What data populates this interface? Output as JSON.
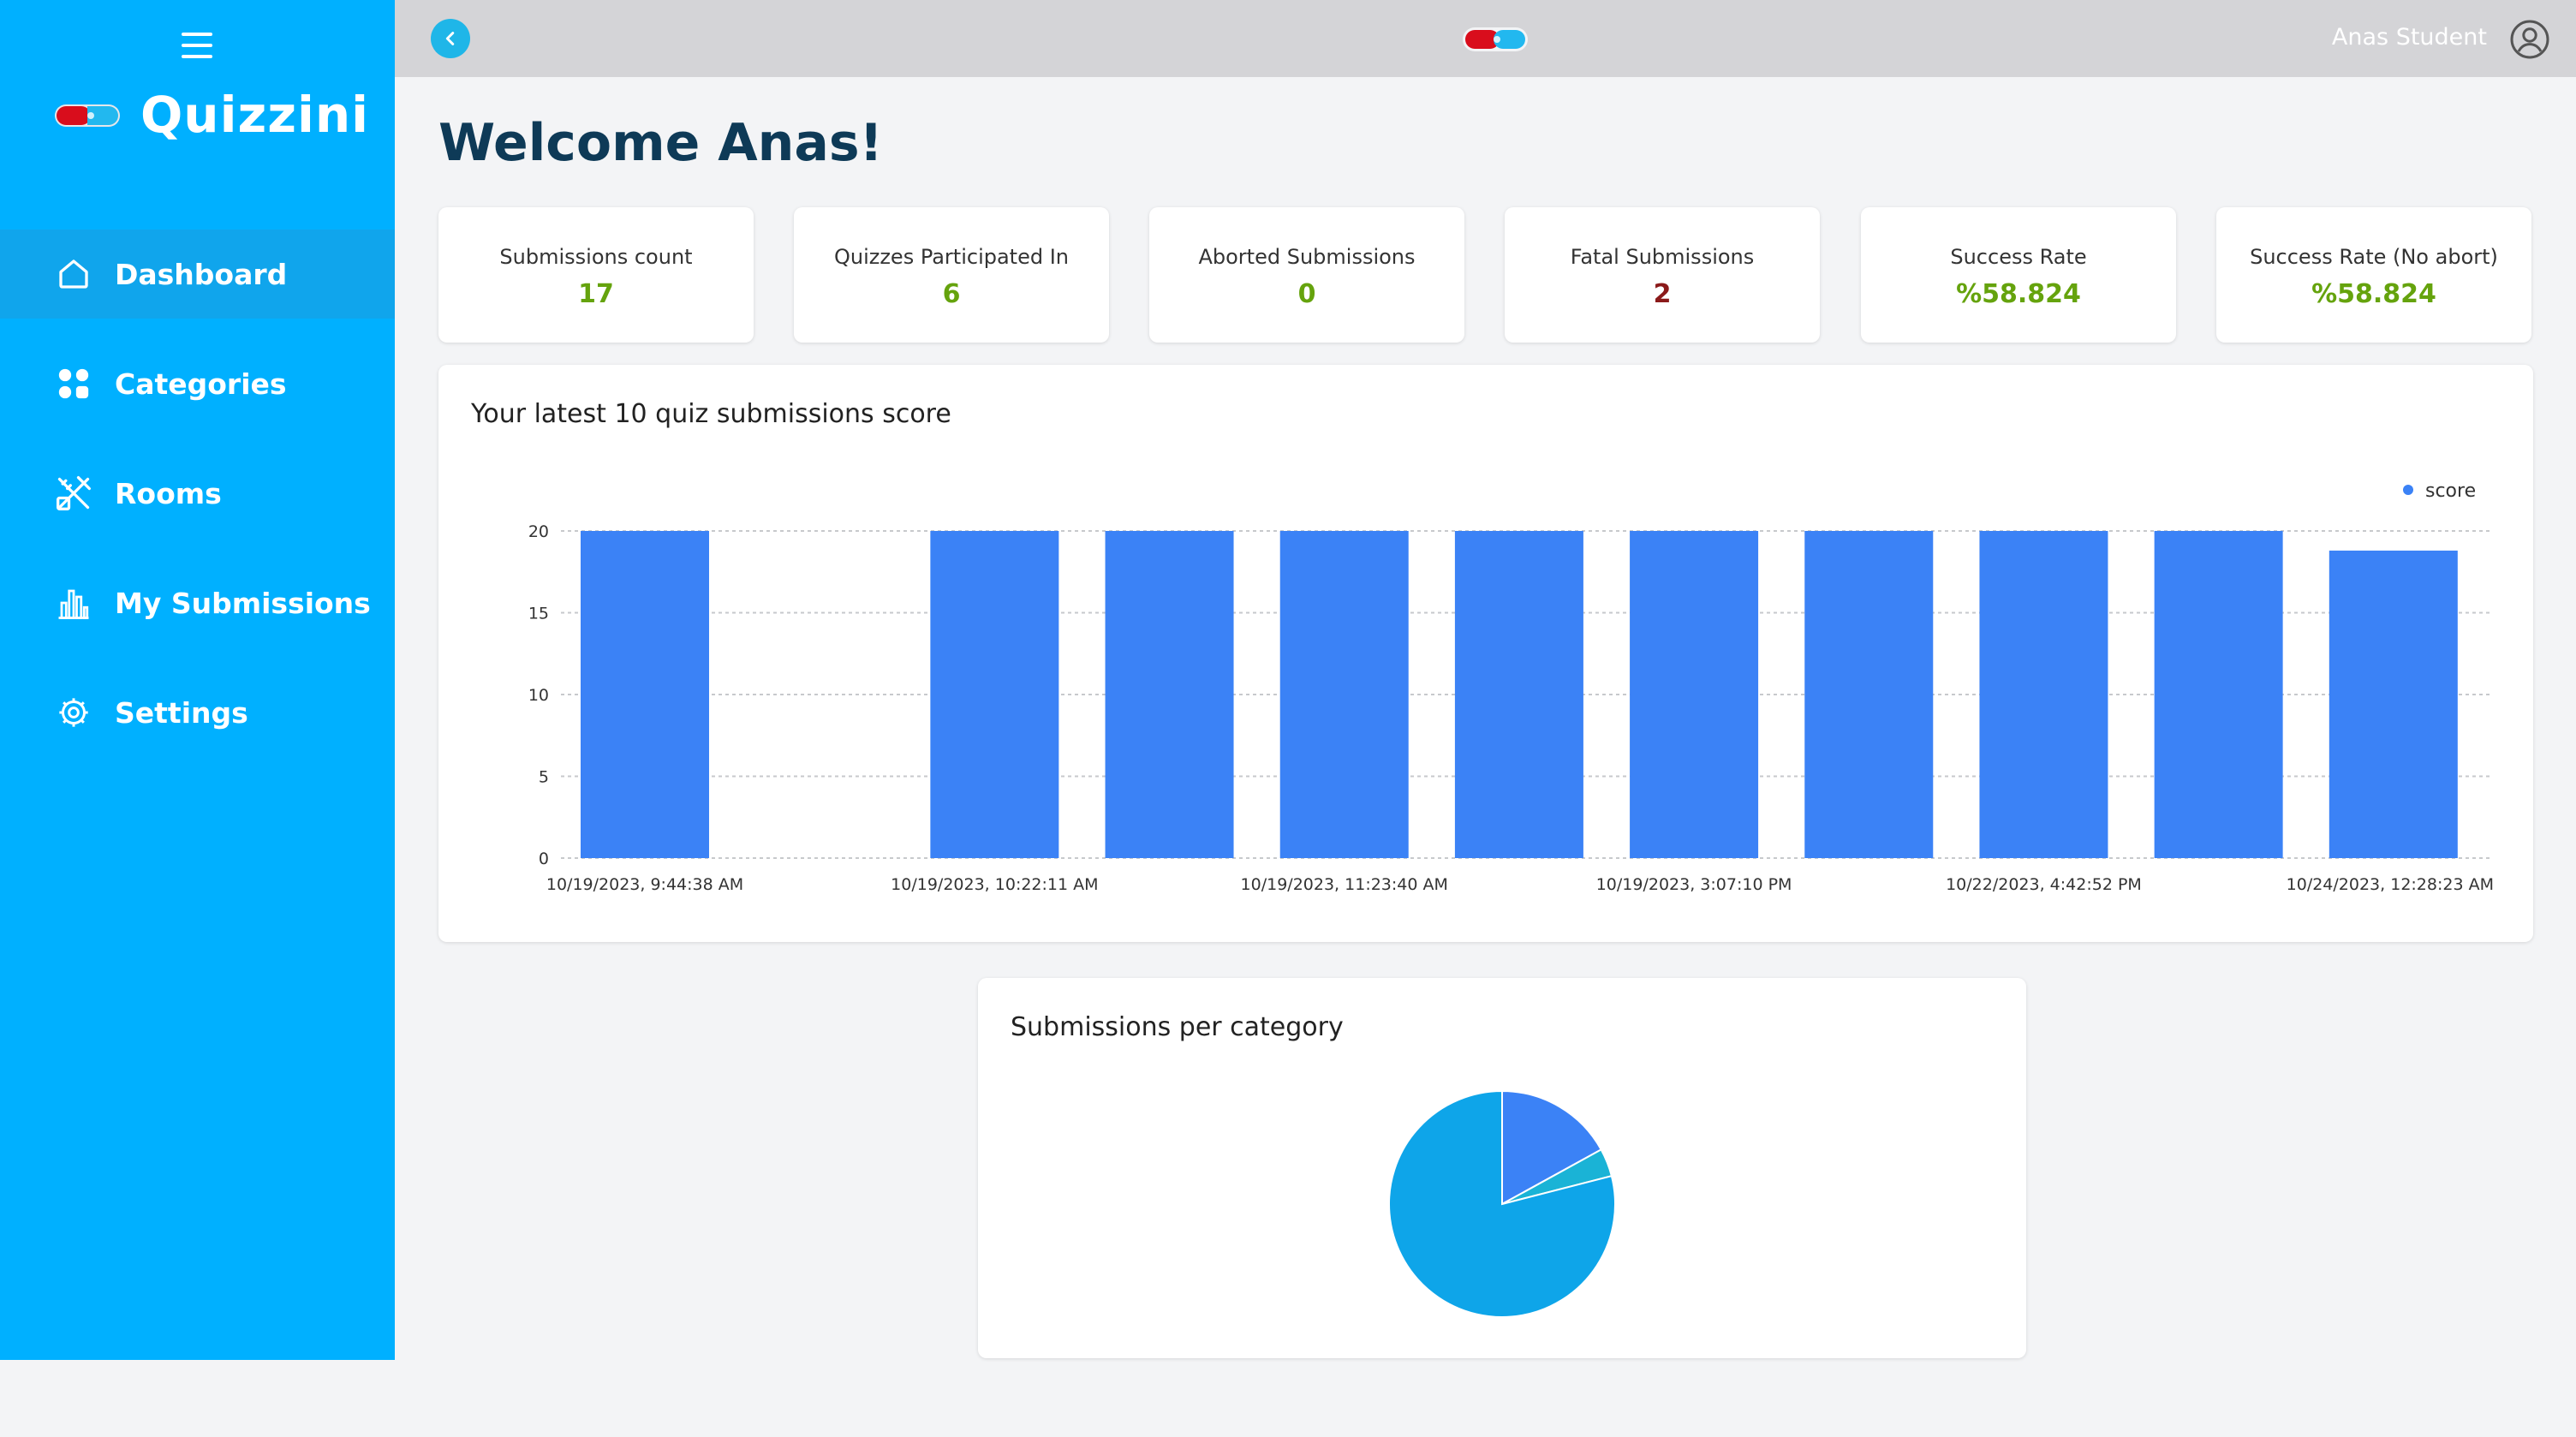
{
  "app": {
    "name": "Quizzini"
  },
  "sidebar": {
    "items": [
      {
        "label": "Dashboard",
        "icon": "home-icon",
        "active": true
      },
      {
        "label": "Categories",
        "icon": "grid-icon",
        "active": false
      },
      {
        "label": "Rooms",
        "icon": "tools-icon",
        "active": false
      },
      {
        "label": "My Submissions",
        "icon": "chart-icon",
        "active": false
      },
      {
        "label": "Settings",
        "icon": "gear-icon",
        "active": false
      }
    ]
  },
  "topbar": {
    "user_name": "Anas Student"
  },
  "welcome": "Welcome Anas!",
  "stats": [
    {
      "label": "Submissions count",
      "value": "17"
    },
    {
      "label": "Quizzes Participated In",
      "value": "6"
    },
    {
      "label": "Aborted Submissions",
      "value": "0"
    },
    {
      "label": "Fatal Submissions",
      "value": "2"
    },
    {
      "label": "Success Rate",
      "value": "%58.824"
    },
    {
      "label": "Success Rate (No abort)",
      "value": "%58.824"
    }
  ],
  "colors": {
    "brand": "#00b0ff",
    "bar": "#3b82f6",
    "success": "#65a30d",
    "fatal": "#8b1a1a"
  },
  "chart_data": [
    {
      "type": "bar",
      "title": "Your latest 10 quiz submissions score",
      "series": [
        {
          "name": "score",
          "values": [
            20,
            0,
            20,
            20,
            20,
            20,
            20,
            20,
            20,
            20,
            18.8
          ]
        }
      ],
      "categories": [
        "10/19/2023, 9:44:38 AM",
        "",
        "10/19/2023, 10:22:11 AM",
        "",
        "10/19/2023, 11:23:40 AM",
        "",
        "10/19/2023, 3:07:10 PM",
        "",
        "10/22/2023, 4:42:52 PM",
        "",
        "10/24/2023, 12:28:23 AM"
      ],
      "ylim": [
        0,
        20
      ],
      "yticks": [
        "0",
        "5",
        "10",
        "15",
        "20"
      ],
      "grid": true,
      "legend": "top-right"
    },
    {
      "type": "pie",
      "title": "Submissions per category",
      "values": [
        17,
        4,
        79
      ],
      "colors": [
        "#3b82f6",
        "#1ab3d6",
        "#0ea5e9"
      ]
    }
  ]
}
